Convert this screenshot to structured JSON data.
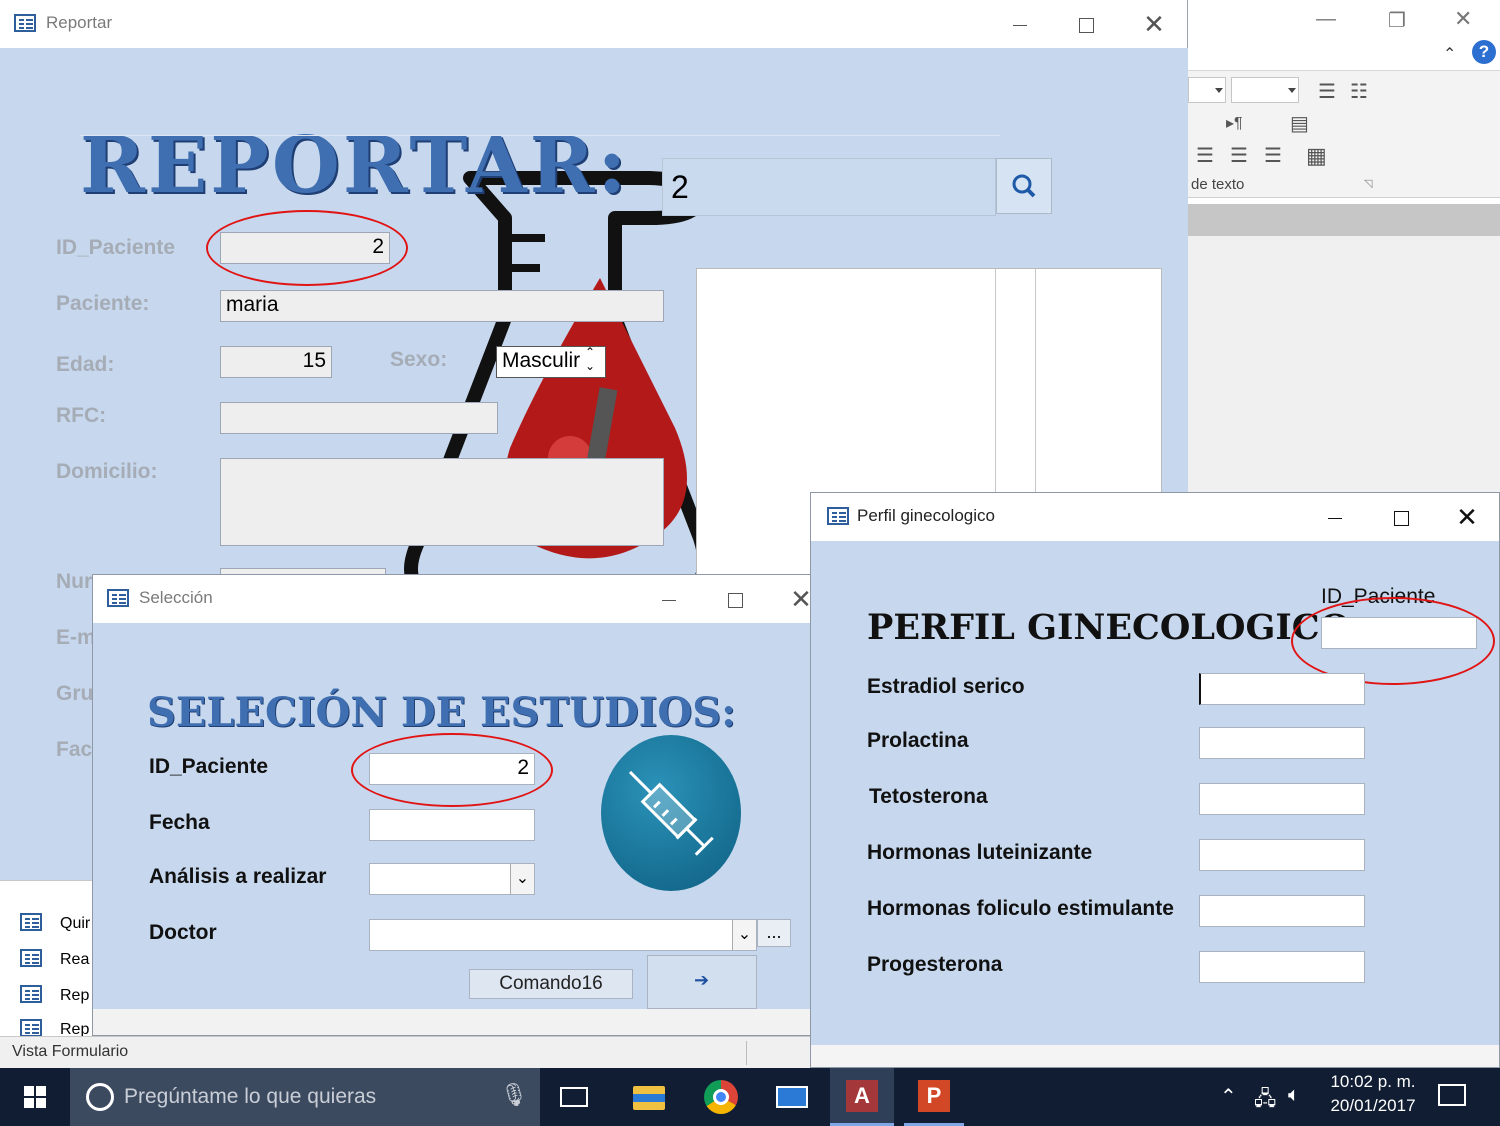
{
  "background_app": {
    "win_controls": [
      "—",
      "❐",
      "✕"
    ],
    "ribbon_group_label": "de texto",
    "icons": [
      "collapse-ribbon-icon",
      "help-icon",
      "bullets-icon",
      "numbering-icon",
      "align-left-icon",
      "center-icon",
      "align-right-icon",
      "gridlines-icon",
      "table-icon"
    ]
  },
  "nav_pane": {
    "items": [
      {
        "label": "Quir"
      },
      {
        "label": "Rea"
      },
      {
        "label": "Rep"
      },
      {
        "label": "Rep"
      }
    ]
  },
  "status_bar": {
    "text": "Vista Formulario"
  },
  "reportar_window": {
    "title": "Reportar",
    "heading": "REPORTAR:",
    "search_value": "2",
    "labels": {
      "id_paciente": "ID_Paciente",
      "paciente": "Paciente:",
      "edad": "Edad:",
      "sexo": "Sexo:",
      "rfc": "RFC:",
      "domicilio": "Domicilio:",
      "num_partial": "Nur",
      "email_partial": "E-m",
      "grupo_partial": "Gru",
      "fac_partial": "Fac"
    },
    "values": {
      "id_paciente": "2",
      "paciente": "maria",
      "edad": "15",
      "sexo": "Masculir",
      "rfc": "",
      "domicilio": ""
    }
  },
  "seleccion_window": {
    "title": "Selección",
    "heading": "SELECIÓN DE ESTUDIOS:",
    "labels": {
      "id_paciente": "ID_Paciente",
      "fecha": "Fecha",
      "analisis": "Análisis a realizar",
      "doctor": "Doctor"
    },
    "values": {
      "id_paciente": "2",
      "fecha": "",
      "analisis": "",
      "doctor": ""
    },
    "ellipsis_button": "...",
    "command_button": "Comando16",
    "next_icon": "arrow-right-icon",
    "image": "syringe-icon"
  },
  "perfil_window": {
    "title": "Perfil ginecologico",
    "heading": "PERFIL GINECOLOGICO:",
    "id_label": "ID_Paciente",
    "id_value": "",
    "fields": [
      {
        "label": "Estradiol serico",
        "value": ""
      },
      {
        "label": "Prolactina",
        "value": ""
      },
      {
        "label": "Tetosterona",
        "value": ""
      },
      {
        "label": "Hormonas luteinizante",
        "value": ""
      },
      {
        "label": "Hormonas foliculo estimulante",
        "value": ""
      },
      {
        "label": "Progesterona",
        "value": ""
      }
    ]
  },
  "taskbar": {
    "search_placeholder": "Pregúntame lo que quieras",
    "time": "10:02 p. m.",
    "date": "20/01/2017",
    "apps": [
      "task-view-icon",
      "file-explorer-icon",
      "chrome-icon",
      "store-icon",
      "access-icon",
      "powerpoint-icon"
    ]
  },
  "colors": {
    "form_background": "#c7d8ee",
    "heading_blue": "#3f6fb0",
    "annotation_red": "#e11414",
    "taskbar": "#101d33"
  }
}
